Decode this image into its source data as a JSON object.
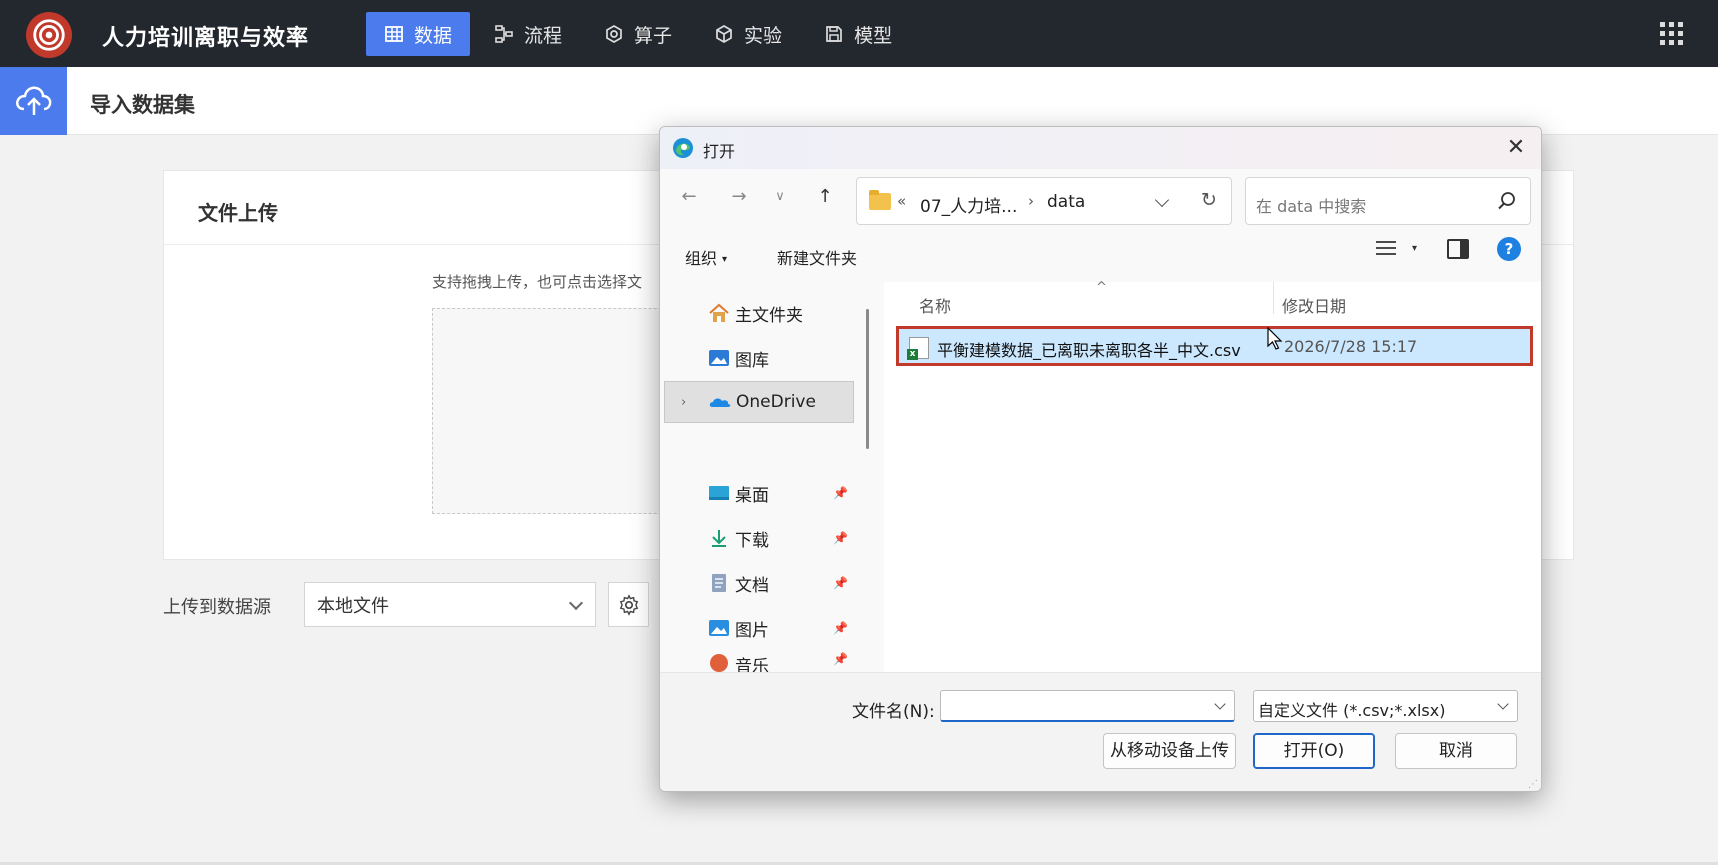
{
  "app": {
    "title": "人力培训离职与效率",
    "nav": [
      {
        "label": "数据",
        "icon": "table-icon",
        "active": true
      },
      {
        "label": "流程",
        "icon": "flow-icon",
        "active": false
      },
      {
        "label": "算子",
        "icon": "hexagon-icon",
        "active": false
      },
      {
        "label": "实验",
        "icon": "cube-icon",
        "active": false
      },
      {
        "label": "模型",
        "icon": "save-icon",
        "active": false
      }
    ],
    "accent": "#4b7bec"
  },
  "subheader": {
    "title": "导入数据集"
  },
  "upload_card": {
    "title": "文件上传",
    "hint": "支持拖拽上传，也可点击选择文"
  },
  "source": {
    "label": "上传到数据源",
    "selected": "本地文件"
  },
  "dialog": {
    "title": "打开",
    "close_glyph": "✕",
    "path": {
      "overflow": "«",
      "parent": "07_人力培...",
      "separator": "›",
      "current": "data"
    },
    "search_placeholder": "在 data 中搜索",
    "commands": {
      "organize": "组织",
      "new_folder": "新建文件夹"
    },
    "help_glyph": "?",
    "nav_items": [
      {
        "label": "主文件夹",
        "icon": "home-icon"
      },
      {
        "label": "图库",
        "icon": "gallery-icon"
      },
      {
        "label": "OneDrive",
        "icon": "onedrive-icon",
        "selected": true
      },
      {
        "label": "桌面",
        "icon": "desktop-icon",
        "pinned": true
      },
      {
        "label": "下载",
        "icon": "download-icon",
        "pinned": true
      },
      {
        "label": "文档",
        "icon": "document-icon",
        "pinned": true
      },
      {
        "label": "图片",
        "icon": "pictures-icon",
        "pinned": true
      },
      {
        "label": "音乐",
        "icon": "music-icon",
        "pinned": true
      }
    ],
    "columns": {
      "name": "名称",
      "modified": "修改日期"
    },
    "files": [
      {
        "name": "平衡建模数据_已离职未离职各半_中文.csv",
        "modified": "2026/7/28 15:17",
        "icon": "csv-file-icon"
      }
    ],
    "filename_label": "文件名(N):",
    "filename_value": "",
    "filetype": "自定义文件 (*.csv;*.xlsx)",
    "buttons": {
      "mobile_upload": "从移动设备上传",
      "open": "打开(O)",
      "cancel": "取消"
    },
    "highlight_color": "#c0392b"
  }
}
